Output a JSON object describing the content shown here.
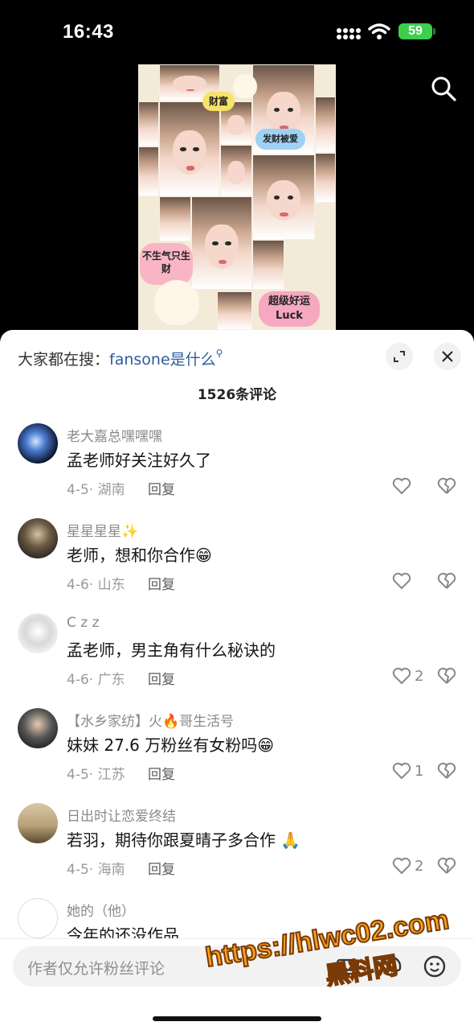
{
  "status_bar": {
    "time": "16:43",
    "battery": "59"
  },
  "video": {
    "stickers": [
      "财富",
      "发财被爱",
      "不生气只生财",
      "超级好运 Luck"
    ]
  },
  "sheet": {
    "hot_search_prefix": "大家都在搜：",
    "hot_search_term": "fansone是什么",
    "comment_count": "1526条评论",
    "reply_label": "回复"
  },
  "comments": [
    {
      "name": "老大嘉总嘿嘿嘿",
      "text": "孟老师好关注好久了",
      "date": "4-5",
      "location": "湖南",
      "likes": ""
    },
    {
      "name": "星星星星✨",
      "text": "老师，想和你合作😁",
      "date": "4-6",
      "location": "山东",
      "likes": ""
    },
    {
      "name": "C z z",
      "text": "孟老师，男主角有什么秘诀的",
      "date": "4-6",
      "location": "广东",
      "likes": "2"
    },
    {
      "name": "【水乡家纺】火🔥哥生活号",
      "text": "妹妹 27.6 万粉丝有女粉吗😁",
      "date": "4-5",
      "location": "江苏",
      "likes": "1"
    },
    {
      "name": "日出时让恋爱终结",
      "text": "若羽，期待你跟夏晴子多合作 🙏",
      "date": "4-5",
      "location": "海南",
      "likes": "2"
    },
    {
      "name": "她的（他）",
      "text": "今年的还没作品",
      "date": "",
      "location": "",
      "likes": ""
    }
  ],
  "input": {
    "placeholder": "作者仅允许粉丝评论"
  },
  "watermark": {
    "url": "https://hlwc02.com",
    "name": "黑料网"
  },
  "colors": {
    "accent_link": "#2e5b9c",
    "battery": "#3ccf4e",
    "watermark": "#f7a21b"
  }
}
